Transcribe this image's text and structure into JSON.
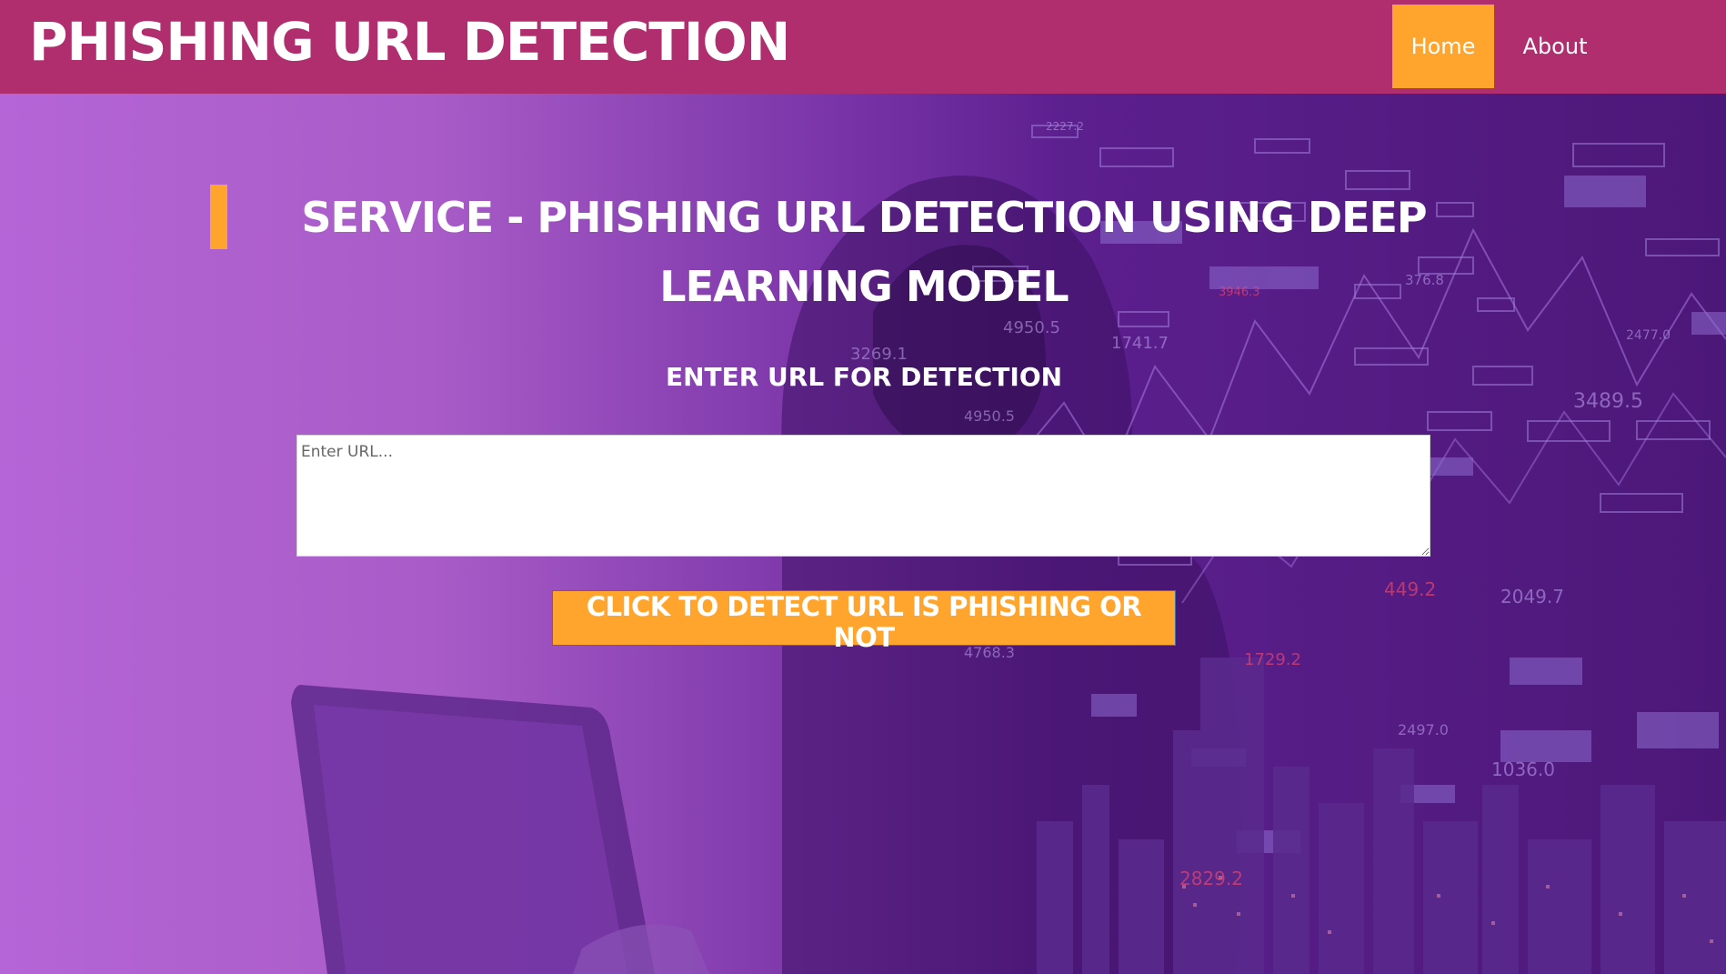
{
  "header": {
    "brand": "PHISHING URL DETECTION",
    "nav": [
      {
        "label": "Home",
        "active": true
      },
      {
        "label": "About",
        "active": false
      }
    ]
  },
  "main": {
    "title": "SERVICE - PHISHING URL DETECTION USING DEEP LEARNING MODEL",
    "subtitle": "ENTER URL FOR DETECTION",
    "url_input": {
      "value": "",
      "placeholder": "Enter URL..."
    },
    "detect_button": "CLICK TO DETECT URL IS PHISHING OR NOT"
  },
  "background_numbers": [
    "2227.2",
    "376.8",
    "3946.3",
    "4950.5",
    "1741.7",
    "3269.1",
    "2477.0",
    "3489.5",
    "4950.5",
    "449.2",
    "2049.7",
    "4768.3",
    "1729.2",
    "2497.0",
    "1036.0",
    "2829.2"
  ],
  "colors": {
    "navbar": "#b02d6e",
    "accent": "#ffa52e",
    "hero_left": "#b565d6",
    "hero_right": "#4c1878"
  }
}
